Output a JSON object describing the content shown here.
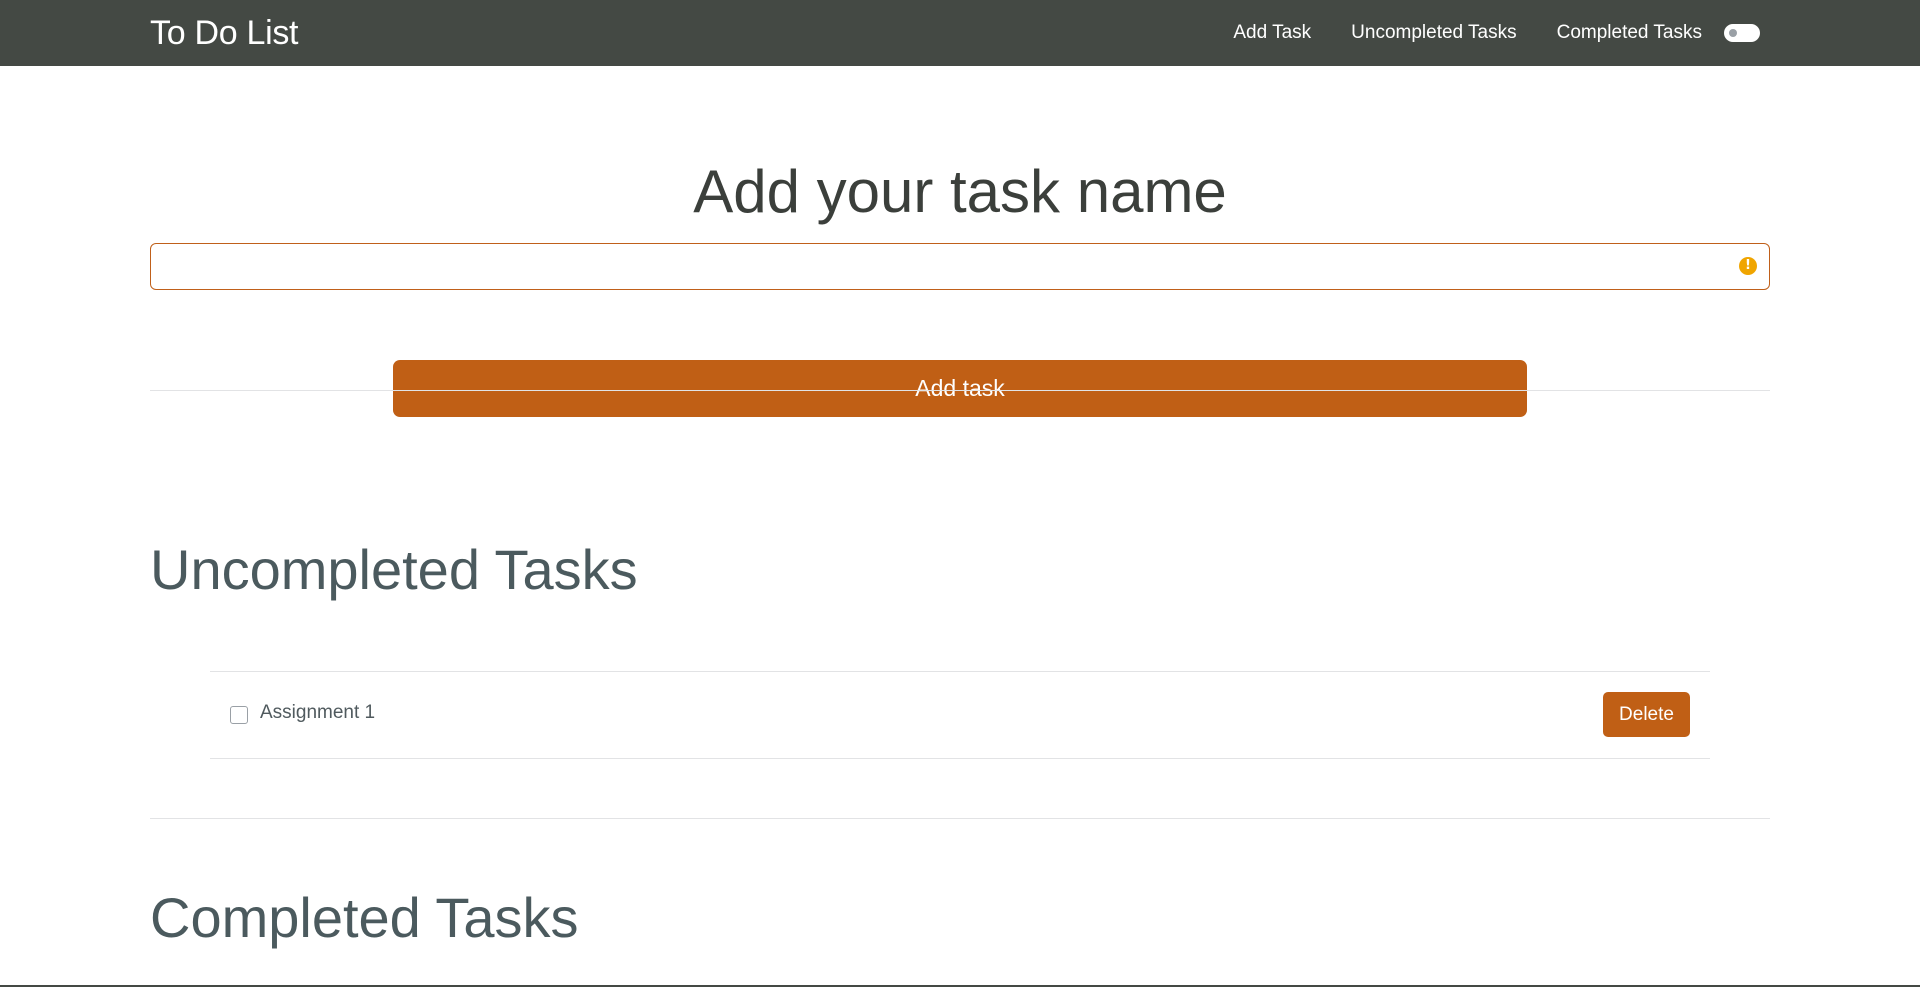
{
  "navbar": {
    "brand": "To Do List",
    "links": [
      "Add Task",
      "Uncompleted Tasks",
      "Completed Tasks"
    ],
    "toggle_on": false
  },
  "add_section": {
    "heading": "Add your task name",
    "input_value": "",
    "input_placeholder": "",
    "button_label": "Add task"
  },
  "uncompleted": {
    "title": "Uncompleted Tasks",
    "tasks": [
      {
        "label": "Assignment 1",
        "checked": false,
        "delete_label": "Delete"
      }
    ]
  },
  "completed": {
    "title": "Completed Tasks"
  },
  "colors": {
    "navbar": "#444944",
    "accent": "#c05f15",
    "warning": "#f0a500"
  },
  "icons": {
    "input_status": "exclamation-warning-icon"
  }
}
